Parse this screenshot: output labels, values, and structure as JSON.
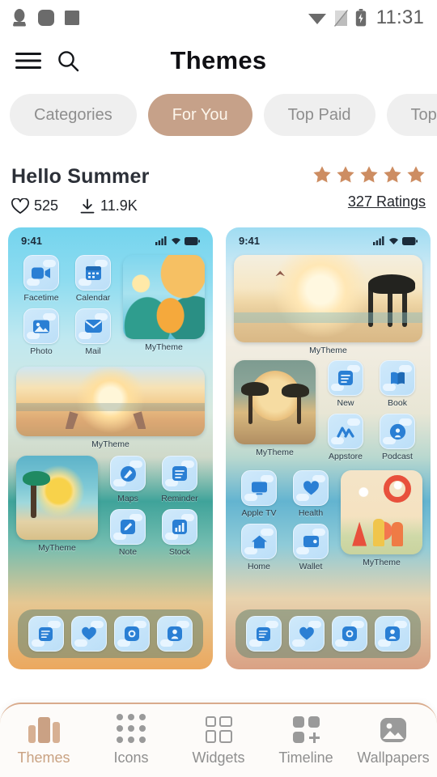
{
  "statusbar": {
    "time": "11:31",
    "left_icons": [
      "qq-penguin-icon",
      "rounded-square-icon",
      "square-icon"
    ],
    "right_icons": [
      "wifi-icon",
      "no-sim-icon",
      "battery-charging-icon"
    ]
  },
  "header": {
    "title": "Themes",
    "menu_icon": "hamburger-menu-icon",
    "search_icon": "search-icon"
  },
  "chips": [
    {
      "label": "Categories",
      "active": false
    },
    {
      "label": "For You",
      "active": true
    },
    {
      "label": "Top Paid",
      "active": false
    },
    {
      "label": "Top",
      "active": false
    }
  ],
  "theme": {
    "title": "Hello Summer",
    "likes": "525",
    "downloads": "11.9K",
    "stars": 5,
    "ratings": "327 Ratings",
    "like_icon": "heart-icon",
    "download_icon": "download-icon",
    "star_icon": "star-icon"
  },
  "colors": {
    "accent": "#c6a189",
    "star": "#cd8d62",
    "nav_active": "#c9a282",
    "chip_bg": "#efefef",
    "chip_text": "#8e8e8e",
    "title_text": "#2c3038"
  },
  "previews": {
    "left": {
      "time": "9:41",
      "rows": [
        {
          "type": "icons-widget",
          "icons": [
            "Facetime",
            "Calendar",
            "Photo",
            "Mail"
          ],
          "widget": {
            "label": "MyTheme",
            "art": "tropical-flowers"
          }
        },
        {
          "type": "wide-widget",
          "widget": {
            "label": "MyTheme",
            "art": "beach-chairs-sunset"
          }
        },
        {
          "type": "widget-icons",
          "widget": {
            "label": "MyTheme",
            "art": "palm-sun"
          },
          "icons": [
            "Maps",
            "Reminder",
            "Note",
            "Stock"
          ]
        }
      ],
      "dock": [
        "news-icon",
        "health-icon",
        "camera-icon",
        "podcast-icon"
      ]
    },
    "right": {
      "time": "9:41",
      "rows": [
        {
          "type": "wide-widget",
          "widget": {
            "label": "MyTheme",
            "art": "beach-palms-birds"
          }
        },
        {
          "type": "widget-icons",
          "widget": {
            "label": "MyTheme",
            "art": "palm-pair-sunset"
          },
          "icons": [
            "New",
            "Book",
            "Appstore",
            "Podcast"
          ]
        },
        {
          "type": "icons-widget",
          "icons": [
            "Apple TV",
            "Health",
            "Home",
            "Wallet"
          ],
          "widget": {
            "label": "MyTheme",
            "art": "summer-picnic"
          }
        }
      ],
      "dock": [
        "news-icon",
        "health-icon",
        "camera-icon",
        "podcast-icon"
      ]
    }
  },
  "bottomnav": [
    {
      "label": "Themes",
      "icon": "themes-icon",
      "active": true
    },
    {
      "label": "Icons",
      "icon": "grid-dots-icon",
      "active": false
    },
    {
      "label": "Widgets",
      "icon": "squares-outline-icon",
      "active": false
    },
    {
      "label": "Timeline",
      "icon": "squares-plus-icon",
      "active": false
    },
    {
      "label": "Wallpapers",
      "icon": "image-icon",
      "active": false
    }
  ]
}
